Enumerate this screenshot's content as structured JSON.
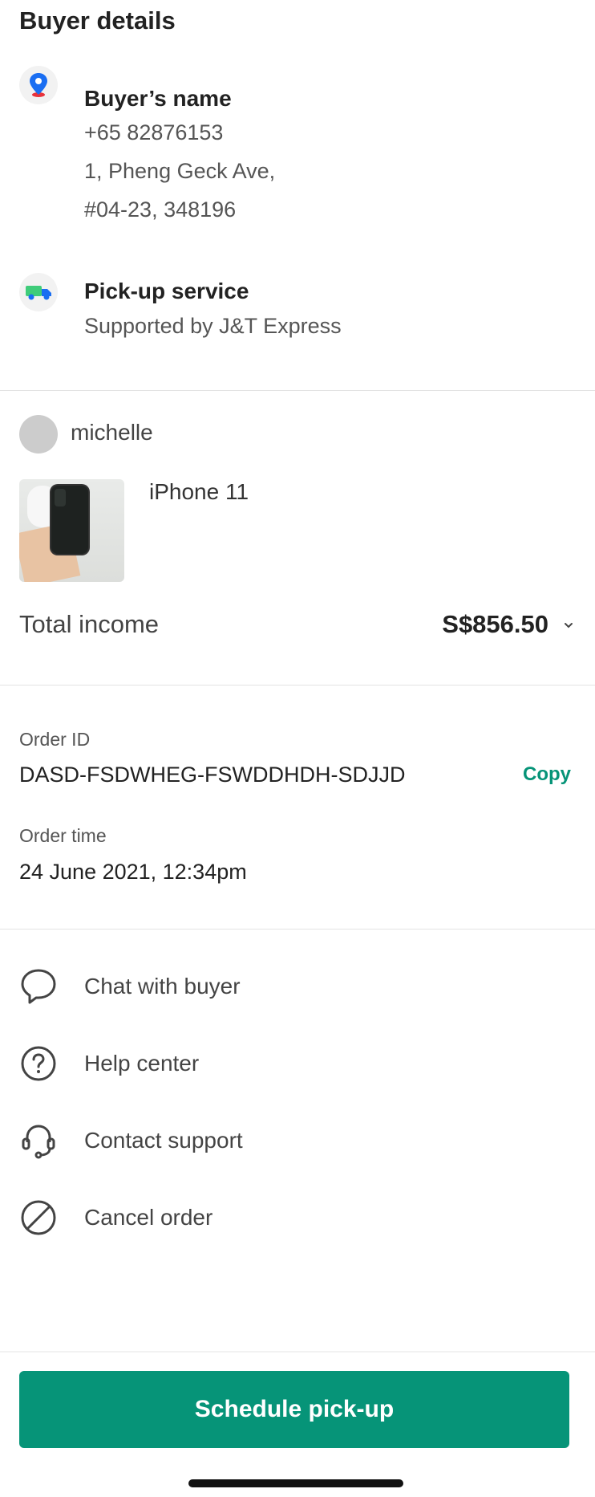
{
  "section_title": "Buyer details",
  "buyer": {
    "name": "Buyer’s name",
    "phone": "+65 82876153",
    "address_line1": "1, Pheng Geck Ave,",
    "address_line2": "#04-23, 348196"
  },
  "pickup": {
    "title": "Pick-up service",
    "subtitle": "Supported by J&T Express"
  },
  "seller": {
    "name": "michelle"
  },
  "product": {
    "name": "iPhone 11"
  },
  "income": {
    "label": "Total income",
    "value": "S$856.50"
  },
  "order": {
    "id_label": "Order ID",
    "id_value": "DASD-FSDWHEG-FSWDDHDH-SDJJD",
    "copy_label": "Copy",
    "time_label": "Order time",
    "time_value": "24 June 2021, 12:34pm"
  },
  "actions": [
    {
      "label": "Chat with buyer",
      "icon": "chat-bubble-icon"
    },
    {
      "label": "Help center",
      "icon": "help-circle-icon"
    },
    {
      "label": "Contact support",
      "icon": "headset-icon"
    },
    {
      "label": "Cancel order",
      "icon": "cancel-circle-icon"
    }
  ],
  "cta_label": "Schedule pick-up",
  "colors": {
    "accent": "#069478",
    "pin_blue": "#1a6ef2",
    "pin_red": "#e8323c",
    "truck_green": "#3fcc7a"
  }
}
